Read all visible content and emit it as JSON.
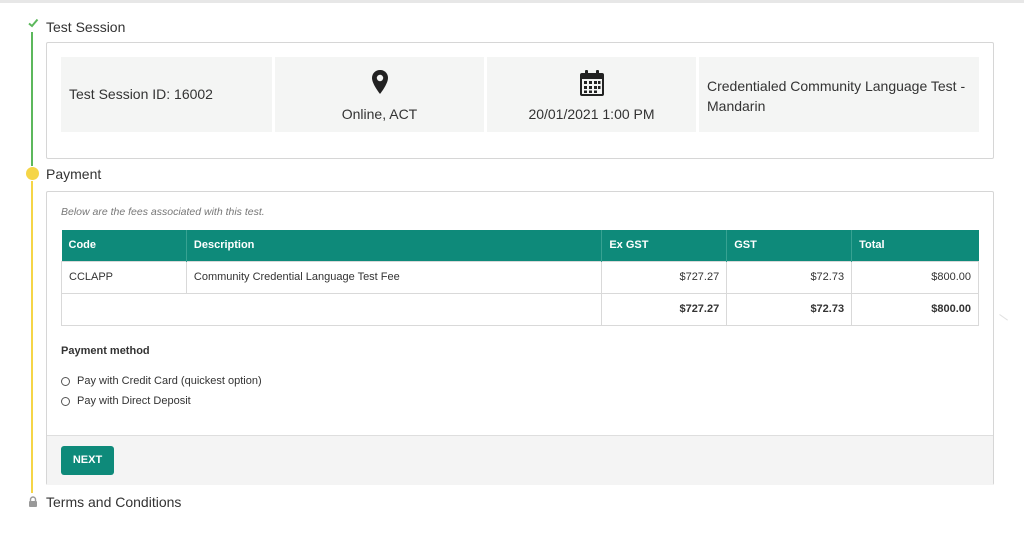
{
  "steps": {
    "session": {
      "title": "Test Session",
      "status_icon": "check-icon",
      "session_id": "Test Session ID: 16002",
      "location": "Online, ACT",
      "location_icon": "map-marker-icon",
      "datetime": "20/01/2021 1:00 PM",
      "datetime_icon": "calendar-icon",
      "test_name": "Credentialed Community Language Test - Mandarin"
    },
    "payment": {
      "title": "Payment",
      "status_icon": "current-step-dot-icon",
      "fees_note": "Below are the fees associated with this test.",
      "table": {
        "headers": [
          "Code",
          "Description",
          "Ex GST",
          "GST",
          "Total"
        ],
        "rows": [
          [
            "CCLAPP",
            "Community Credential Language Test Fee",
            "$727.27",
            "$72.73",
            "$800.00"
          ]
        ],
        "totals": [
          "",
          "$727.27",
          "$72.73",
          "$800.00"
        ]
      },
      "payment_method_label": "Payment method",
      "options": [
        "Pay with Credit Card (quickest option)",
        "Pay with Direct Deposit"
      ],
      "next_label": "NEXT"
    },
    "terms": {
      "title": "Terms and Conditions",
      "status_icon": "lock-icon"
    }
  },
  "colors": {
    "accent": "#0e8a7a",
    "complete": "#5cb85c",
    "current": "#f5d547"
  }
}
